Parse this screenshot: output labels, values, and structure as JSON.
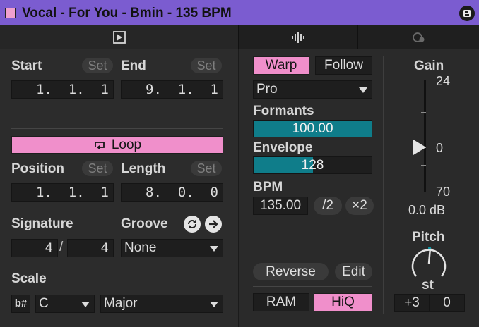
{
  "title_bar": {
    "title": "Vocal - For You - Bmin - 135 BPM",
    "clip_color": "#f0a0cf",
    "accent": "#7b5cd0"
  },
  "tabs": [
    {
      "name": "clip-view-tab",
      "icon": "clip-icon",
      "active": true
    },
    {
      "name": "audio-tab",
      "icon": "waveform-icon",
      "active": false
    },
    {
      "name": "envelopes-tab",
      "icon": "envelope-icon",
      "active": false
    }
  ],
  "clip": {
    "start_label": "Start",
    "end_label": "End",
    "set_label": "Set",
    "start_value": " 1.  1.  1",
    "end_value": " 9.  1.  1",
    "loop_label": "Loop",
    "position_label": "Position",
    "length_label": "Length",
    "position_value": " 1.  1.  1",
    "length_value": " 8.  0.  0",
    "signature_label": "Signature",
    "groove_label": "Groove",
    "sig_numerator": "4",
    "sig_slash": "/",
    "sig_denominator": "4",
    "groove_value": "None",
    "scale_label": "Scale",
    "scale_icon": "b#",
    "scale_root": "C",
    "scale_mode": "Major"
  },
  "audio": {
    "warp_label": "Warp",
    "follow_label": "Follow",
    "warp_mode": "Pro",
    "formants_label": "Formants",
    "formants_value": "100.00",
    "formants_fraction": 1.0,
    "envelope_label": "Envelope",
    "envelope_value": "128",
    "envelope_fraction": 0.5,
    "bpm_label": "BPM",
    "bpm_value": "135.00",
    "half_label": "/2",
    "double_label": "×2",
    "reverse_label": "Reverse",
    "edit_label": "Edit",
    "ram_label": "RAM",
    "hiq_label": "HiQ",
    "accent": "#f08fcb",
    "teal": "#0f7d8a"
  },
  "gain_pitch": {
    "gain_label": "Gain",
    "gain_top": "24",
    "gain_zero": "0",
    "gain_bottom": "70",
    "gain_value": "0.0 dB",
    "pitch_label": "Pitch",
    "pitch_unit": "st",
    "pitch_coarse": "+3",
    "pitch_fine": "0"
  }
}
